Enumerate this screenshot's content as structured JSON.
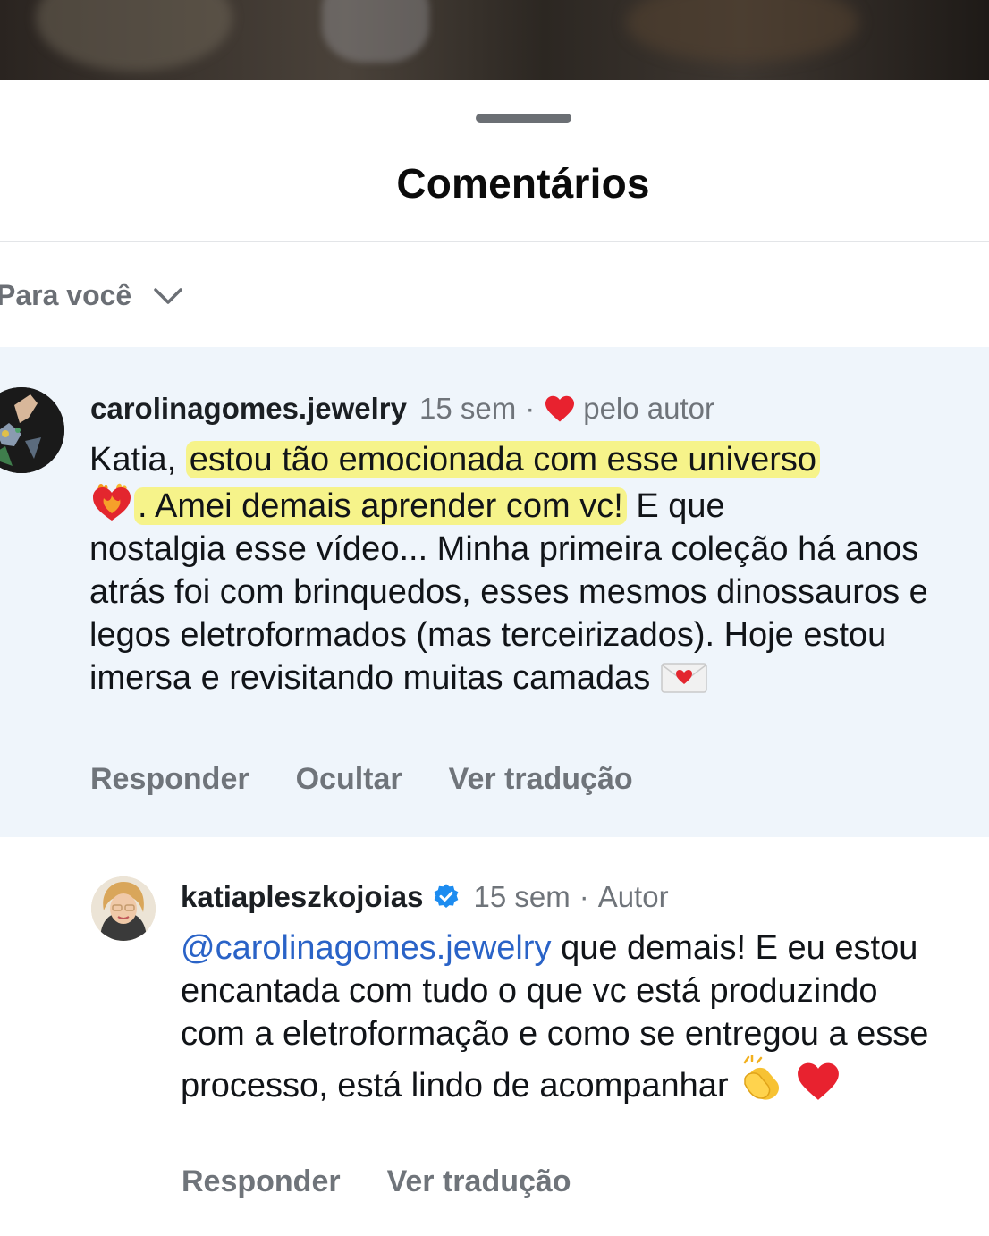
{
  "sheet": {
    "title": "Comentários",
    "filter_label": "Para você"
  },
  "comments": [
    {
      "username": "carolinagomes.jewelry",
      "time": "15 sem",
      "separator": "·",
      "liked_by_author_label": "pelo autor",
      "text_before": "Katia, ",
      "text_highlight_1": "estou tão emocionada com esse universo",
      "text_highlight_2": ". Amei demais aprender com vc!",
      "text_rest_1": " E que",
      "text_rest_2": "nostalgia esse vídeo... Minha primeira coleção há anos atrás foi com brinquedos, esses mesmos dinossauros e legos eletroformados (mas terceirizados). Hoje estou imersa e revisitando muitas camadas",
      "actions": {
        "reply": "Responder",
        "hide": "Ocultar",
        "translate": "Ver tradução"
      }
    },
    {
      "username": "katiapleszkojoias",
      "verified": true,
      "time": "15 sem",
      "separator": "·",
      "author_label": "Autor",
      "mention": "@carolinagomes.jewelry",
      "text": " que demais! E eu estou encantada com tudo o que vc está produzindo com a eletroformação e como se entregou a esse processo, está lindo de acompanhar",
      "actions": {
        "reply": "Responder",
        "translate": "Ver tradução"
      }
    }
  ],
  "icons": {
    "filter_chevron": "chevron-down-icon",
    "liked_heart": "heart-icon",
    "verified_badge": "verified-badge-icon",
    "emoji_heart_on_fire": "heart-on-fire-emoji",
    "emoji_love_letter": "love-letter-emoji",
    "emoji_clapping": "clapping-hands-emoji",
    "emoji_red_heart": "red-heart-emoji"
  },
  "colors": {
    "highlight_marker": "#f6f38a",
    "mention_blue": "#2a63c7",
    "heart_red": "#e8222f",
    "verified_blue": "#1d8cf0",
    "highlighted_comment_bg": "#eff5fb"
  }
}
